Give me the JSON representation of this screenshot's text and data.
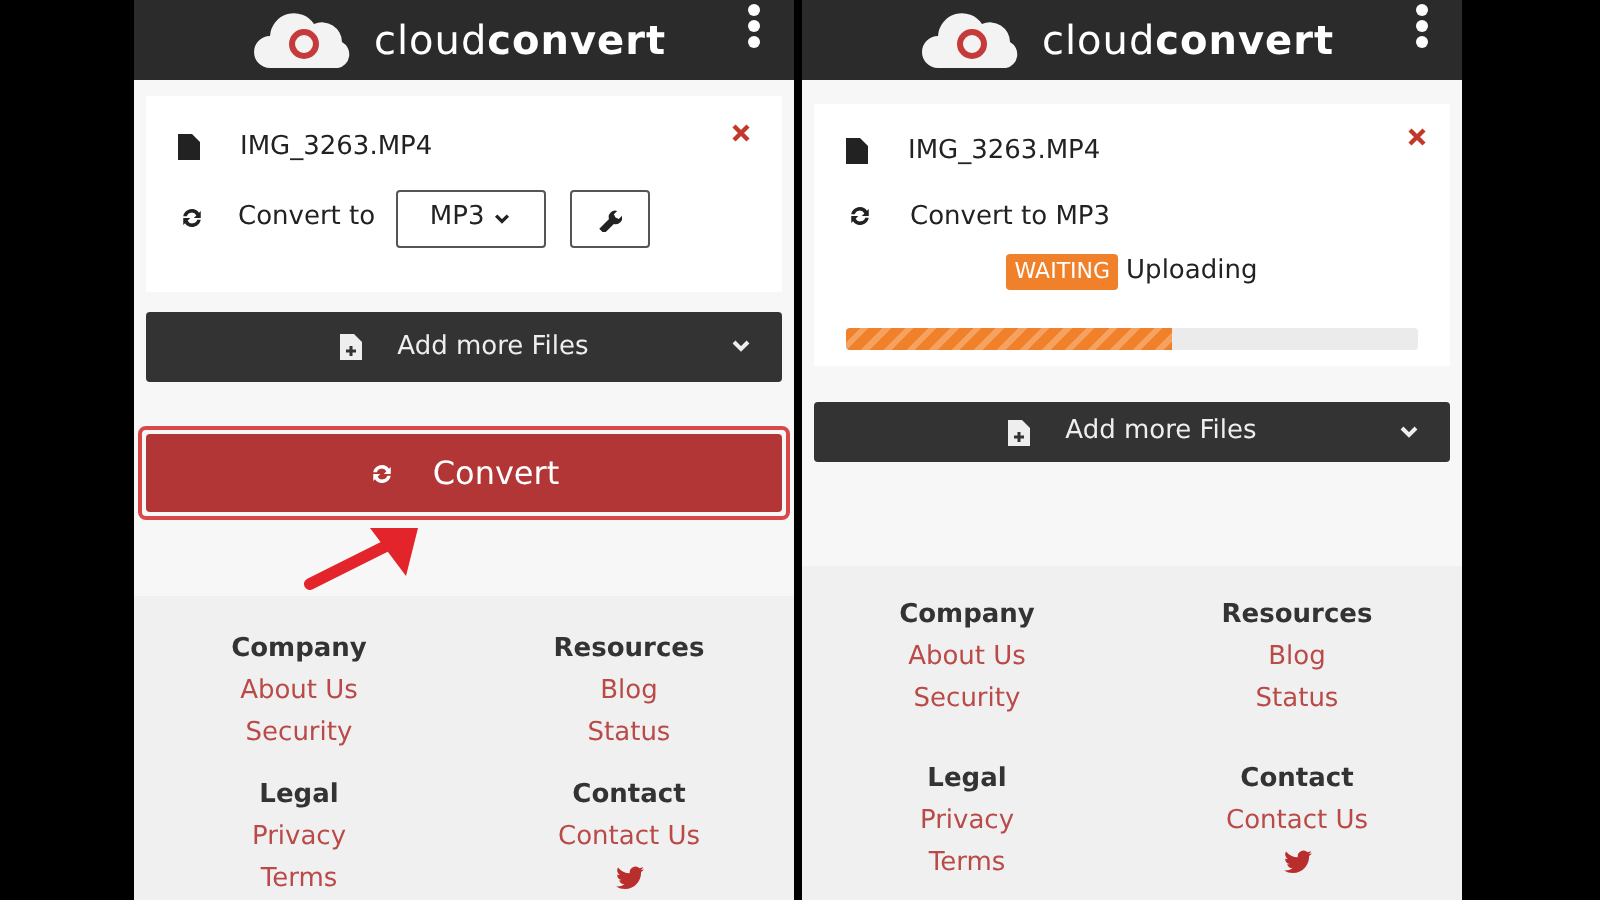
{
  "screens": [
    {
      "kind": "options",
      "brand": {
        "light": "cloud",
        "bold": "convert"
      },
      "file_name": "IMG_3263.MP4",
      "convert_label": "Convert to",
      "format": "MP3",
      "add_files": "Add more Files",
      "convert_button": "Convert",
      "footer": [
        {
          "title": "Company",
          "links": [
            "About Us",
            "Security"
          ]
        },
        {
          "title": "Resources",
          "links": [
            "Blog",
            "Status"
          ]
        },
        {
          "title": "Legal",
          "links": [
            "Privacy",
            "Terms"
          ]
        },
        {
          "title": "Contact",
          "links": [
            "Contact Us"
          ],
          "twitter": true
        }
      ]
    },
    {
      "kind": "progress",
      "brand": {
        "light": "cloud",
        "bold": "convert"
      },
      "file_name": "IMG_3263.MP4",
      "convert_label": "Convert to MP3",
      "status_badge": "WAITING",
      "status_text": "Uploading",
      "progress": {
        "level": 0.57
      },
      "add_files": "Add more Files",
      "footer": [
        {
          "title": "Company",
          "links": [
            "About Us",
            "Security"
          ]
        },
        {
          "title": "Resources",
          "links": [
            "Blog",
            "Status"
          ]
        },
        {
          "title": "Legal",
          "links": [
            "Privacy",
            "Terms"
          ]
        },
        {
          "title": "Contact",
          "links": [
            "Contact Us"
          ],
          "twitter": true
        }
      ]
    }
  ]
}
